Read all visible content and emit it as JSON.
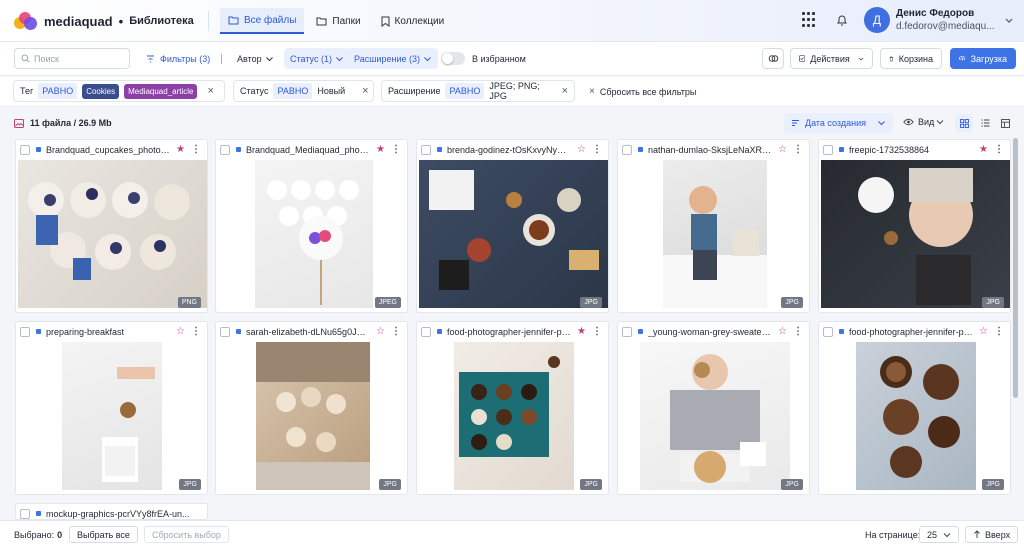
{
  "header": {
    "brand": "mediaquad",
    "separator": "•",
    "section": "Библиотека",
    "tabs": [
      {
        "label": "Все файлы",
        "active": true
      },
      {
        "label": "Папки",
        "active": false
      },
      {
        "label": "Коллекции",
        "active": false
      }
    ],
    "user": {
      "initial": "Д",
      "name": "Денис Федоров",
      "email": "d.fedorov@mediaqu..."
    }
  },
  "toolbar": {
    "search_placeholder": "Поиск",
    "filters_label": "Фильтры (3)",
    "divider": "|",
    "author_label": "Автор",
    "status_label": "Статус (1)",
    "extension_label": "Расширение (3)",
    "favorites_label": "В избранном",
    "actions_label": "Действия",
    "trash_label": "Корзина",
    "upload_label": "Загрузка"
  },
  "filters": {
    "tag": {
      "label": "Тег",
      "operator": "РАВНО",
      "values": [
        {
          "text": "Cookies",
          "color": "#3a4d8f"
        },
        {
          "text": "Mediaquad_article",
          "color": "#8d3fa8"
        }
      ]
    },
    "status": {
      "label": "Статус",
      "operator": "РАВНО",
      "value": "Новый"
    },
    "extension": {
      "label": "Расширение",
      "operator": "РАВНО",
      "value": "JPEG; PNG; JPG"
    },
    "reset_label": "Сбросить все фильтры",
    "close_glyph": "×"
  },
  "summary": {
    "count_text": "11 файла / 26.9 Mb",
    "sort_label": "Дата создания",
    "view_label": "Вид"
  },
  "files": [
    {
      "name": "Brandquad_cupcakes_photo_2024-...",
      "ext": "PNG",
      "starred": true
    },
    {
      "name": "Brandquad_Mediaquad_photo_2...",
      "ext": "JPEG",
      "starred": true
    },
    {
      "name": "brenda-godinez-tOsKxvyNyDw-u...",
      "ext": "JPG",
      "starred": false
    },
    {
      "name": "nathan-dumlao-SksjLeNaXRk-uns...",
      "ext": "JPG",
      "starred": false
    },
    {
      "name": "freepic-1732538864",
      "ext": "JPG",
      "starred": true
    },
    {
      "name": "preparing-breakfast",
      "ext": "JPG",
      "starred": false
    },
    {
      "name": "sarah-elizabeth-dLNu65g0JMA-un...",
      "ext": "JPG",
      "starred": false
    },
    {
      "name": "food-photographer-jennifer-palli...",
      "ext": "JPG",
      "starred": true
    },
    {
      "name": "_young-woman-grey-sweater-eati...",
      "ext": "JPG",
      "starred": false
    },
    {
      "name": "food-photographer-jennifer-palli...",
      "ext": "JPG",
      "starred": false
    },
    {
      "name": "mockup-graphics-pcrVYy8frEA-un...",
      "ext": "JPG",
      "starred": false
    }
  ],
  "bottom": {
    "selected_label": "Выбрано:",
    "selected_count": "0",
    "select_all": "Выбрать все",
    "clear_selection": "Сбросить выбор",
    "per_page_label": "На странице:",
    "per_page_value": "25",
    "up_label": "Вверх"
  },
  "colors": {
    "accent": "#3d73e6",
    "star": "#c0407a",
    "badge": "#727883"
  },
  "icons": [
    "folder-icon",
    "bookmark-icon",
    "apps-grid-icon",
    "bell-icon",
    "chevron-down-icon",
    "search-icon",
    "filter-icon",
    "toggle-icon",
    "ai-icon",
    "checkbox-icon",
    "trash-icon",
    "upload-icon",
    "close-icon",
    "image-icon",
    "sort-icon",
    "eye-icon",
    "grid-view-icon",
    "list-view-icon",
    "table-view-icon",
    "star-icon",
    "more-icon",
    "arrow-up-icon"
  ]
}
